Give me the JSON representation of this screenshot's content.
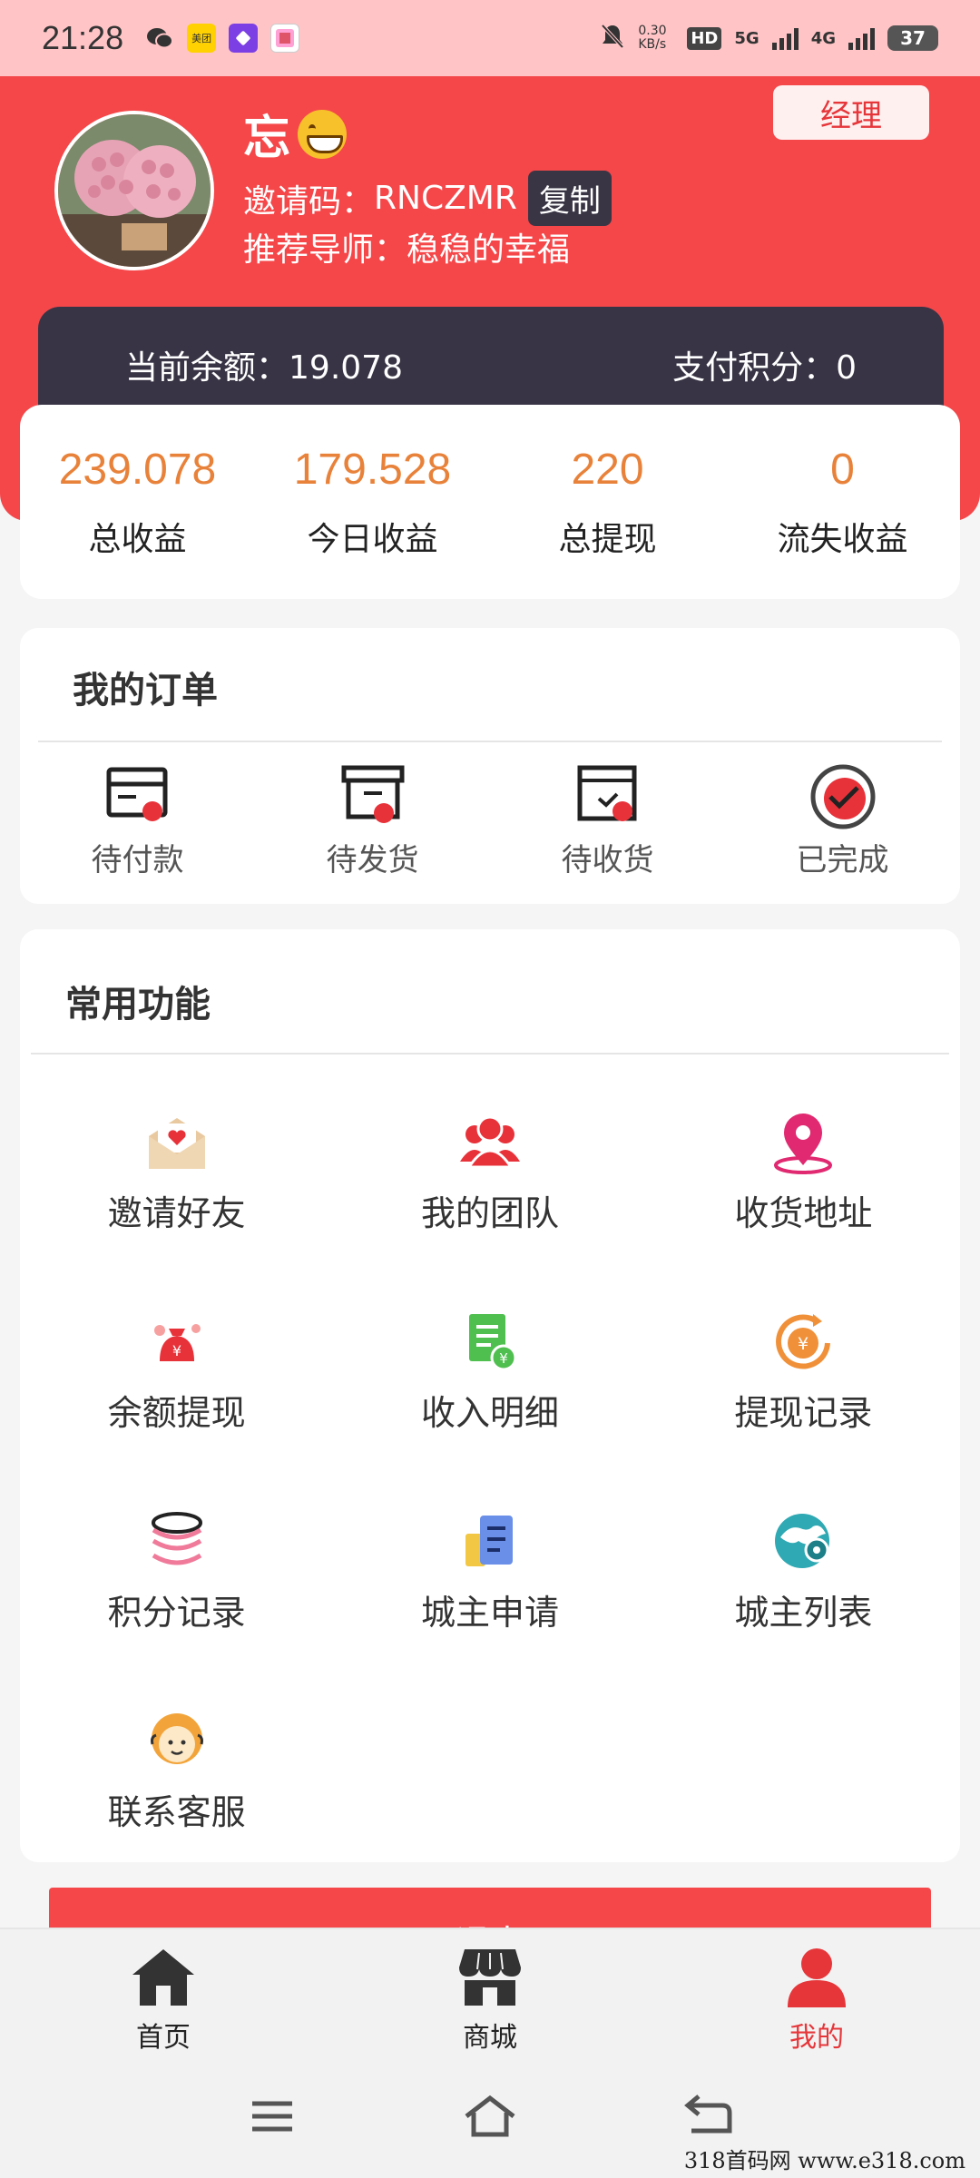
{
  "status_bar": {
    "time": "21:28",
    "network_speed": "0.30 KB/s",
    "hd": "HD",
    "sim1": "5G",
    "sim2": "4G",
    "battery": "37",
    "apps": [
      "wechat-icon",
      "meituan-icon",
      "app-purple-icon",
      "app-game-icon"
    ],
    "meituan_label": "美团"
  },
  "profile": {
    "username": "忘",
    "invite_label": "邀请码：",
    "invite_code": "RNCZMR",
    "copy_label": "复制",
    "mentor_label": "推荐导师：",
    "mentor_name": "稳稳的幸福",
    "manager_label": "经理"
  },
  "balance": {
    "current_label": "当前余额：",
    "current_value": "19.078",
    "points_label": "支付积分：",
    "points_value": "0"
  },
  "stats": [
    {
      "value": "239.078",
      "label": "总收益"
    },
    {
      "value": "179.528",
      "label": "今日收益"
    },
    {
      "value": "220",
      "label": "总提现"
    },
    {
      "value": "0",
      "label": "流失收益"
    }
  ],
  "orders": {
    "title": "我的订单",
    "items": [
      {
        "label": "待付款",
        "icon": "wallet-card-icon"
      },
      {
        "label": "待发货",
        "icon": "archive-box-icon"
      },
      {
        "label": "待收货",
        "icon": "parcel-check-icon"
      },
      {
        "label": "已完成",
        "icon": "check-circle-icon"
      }
    ]
  },
  "functions": {
    "title": "常用功能",
    "items": [
      {
        "label": "邀请好友",
        "icon": "envelope-heart-icon"
      },
      {
        "label": "我的团队",
        "icon": "team-people-icon"
      },
      {
        "label": "收货地址",
        "icon": "location-pin-icon"
      },
      {
        "label": "余额提现",
        "icon": "money-bag-icon"
      },
      {
        "label": "收入明细",
        "icon": "document-yuan-icon"
      },
      {
        "label": "提现记录",
        "icon": "yuan-refresh-icon"
      },
      {
        "label": "积分记录",
        "icon": "coin-stack-icon"
      },
      {
        "label": "城主申请",
        "icon": "application-doc-icon"
      },
      {
        "label": "城主列表",
        "icon": "globe-pin-icon"
      },
      {
        "label": "联系客服",
        "icon": "customer-service-icon"
      }
    ]
  },
  "logout_label": "退出",
  "tabs": [
    {
      "label": "首页",
      "icon": "home-icon"
    },
    {
      "label": "商城",
      "icon": "store-icon"
    },
    {
      "label": "我的",
      "icon": "user-icon"
    }
  ],
  "watermark": "318首码网  www.e318.com",
  "colors": {
    "primary_red": "#f5474a",
    "dark_bar": "#393445",
    "stat_orange": "#e8823a",
    "status_bar_bg": "#ffc4c6"
  }
}
